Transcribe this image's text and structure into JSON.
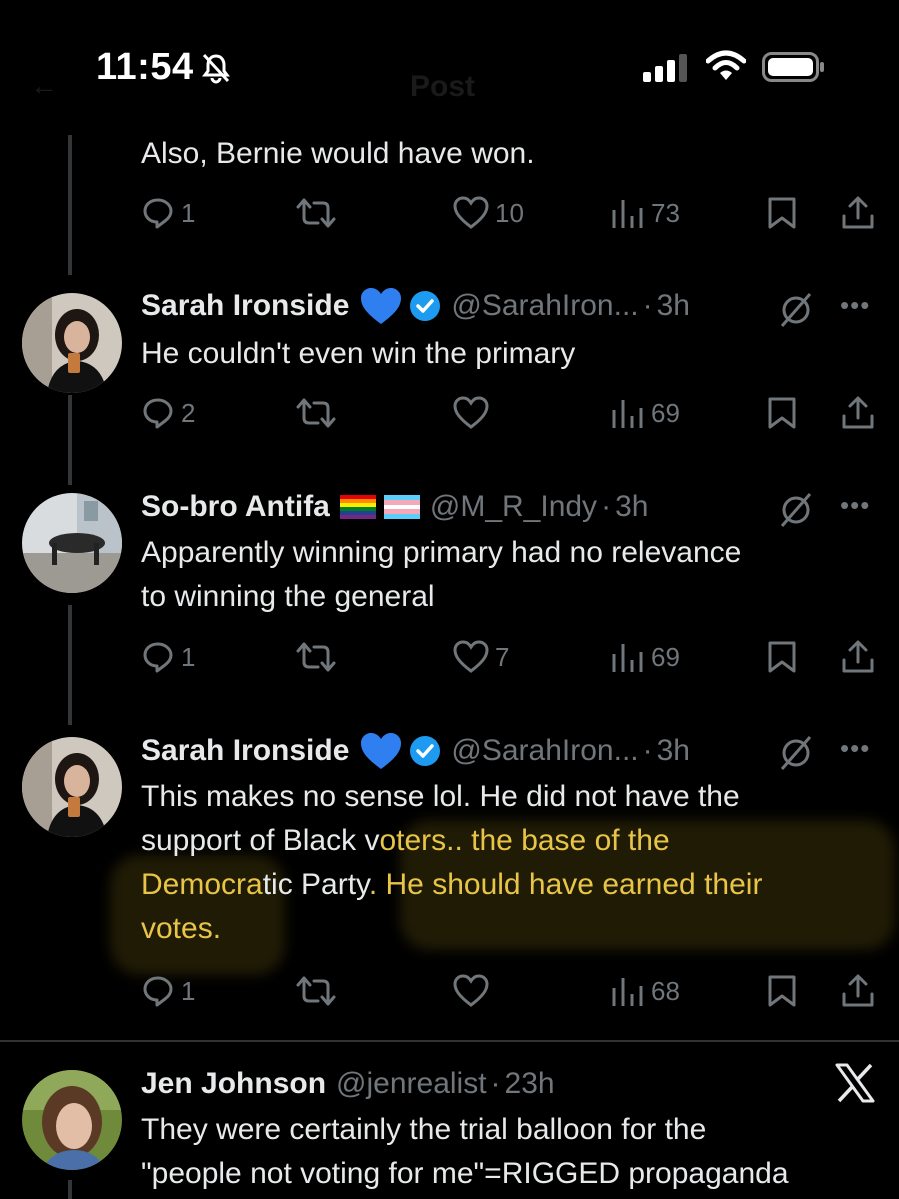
{
  "status_bar": {
    "time": "11:54"
  },
  "tweets": [
    {
      "text": "Also, Bernie would have won.",
      "replies": "1",
      "likes": "10",
      "views": "73"
    },
    {
      "name": "Sarah Ironside",
      "handle": "@SarahIron...",
      "ago": "3h",
      "text": "He couldn't even win the primary",
      "replies": "2",
      "likes": "",
      "views": "69"
    },
    {
      "name": "So-bro Antifa",
      "handle": "@M_R_Indy",
      "ago": "3h",
      "text_line1": "Apparently winning primary had no relevance",
      "text_line2": "to winning the general",
      "replies": "1",
      "likes": "7",
      "views": "69"
    },
    {
      "name": "Sarah Ironside",
      "handle": "@SarahIron...",
      "ago": "3h",
      "text_line1": "This makes no sense lol. He did not have the",
      "text_line2a": "support of Black v",
      "text_line2b": "oters.. the base of the",
      "text_line3a": "Democra",
      "text_line3b": "tic Party",
      "text_line3c": ". He should have earned their",
      "text_line4": "votes.",
      "replies": "1",
      "likes": "",
      "views": "68"
    },
    {
      "name": "Jen Johnson",
      "handle": "@jenrealist",
      "ago": "23h",
      "text_line1": "They were certainly the trial balloon for the",
      "text_line2": "\"people not voting for me\"=RIGGED propaganda"
    }
  ],
  "colors": {
    "background": "#000000",
    "text": "#e7e9ea",
    "muted": "#71767b",
    "verified": "#1d9bf0",
    "highlight": "#e8c547"
  },
  "icons": [
    "bell-slash-icon",
    "signal-icon",
    "wifi-icon",
    "battery-icon",
    "reply-icon",
    "retweet-icon",
    "like-icon",
    "views-icon",
    "bookmark-icon",
    "share-icon",
    "blue-heart-icon",
    "verified-badge-icon",
    "grok-icon",
    "more-icon",
    "x-logo-icon",
    "rainbow-flag-icon",
    "trans-flag-icon"
  ]
}
